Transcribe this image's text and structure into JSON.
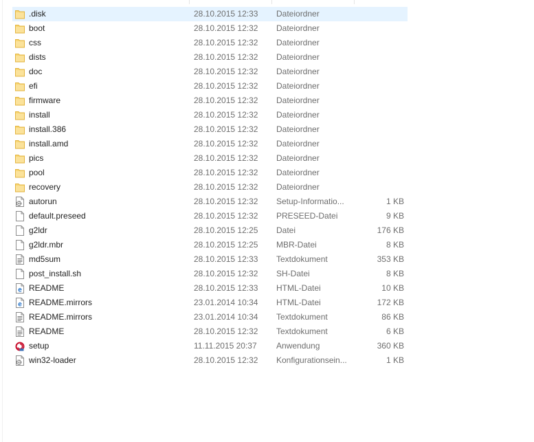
{
  "files": [
    {
      "name": ".disk",
      "date": "28.10.2015 12:33",
      "type": "Dateiordner",
      "size": "",
      "icon": "folder-icon",
      "selected": true
    },
    {
      "name": "boot",
      "date": "28.10.2015 12:32",
      "type": "Dateiordner",
      "size": "",
      "icon": "folder-icon"
    },
    {
      "name": "css",
      "date": "28.10.2015 12:32",
      "type": "Dateiordner",
      "size": "",
      "icon": "folder-icon"
    },
    {
      "name": "dists",
      "date": "28.10.2015 12:32",
      "type": "Dateiordner",
      "size": "",
      "icon": "folder-icon"
    },
    {
      "name": "doc",
      "date": "28.10.2015 12:32",
      "type": "Dateiordner",
      "size": "",
      "icon": "folder-icon"
    },
    {
      "name": "efi",
      "date": "28.10.2015 12:32",
      "type": "Dateiordner",
      "size": "",
      "icon": "folder-icon"
    },
    {
      "name": "firmware",
      "date": "28.10.2015 12:32",
      "type": "Dateiordner",
      "size": "",
      "icon": "folder-icon"
    },
    {
      "name": "install",
      "date": "28.10.2015 12:32",
      "type": "Dateiordner",
      "size": "",
      "icon": "folder-icon"
    },
    {
      "name": "install.386",
      "date": "28.10.2015 12:32",
      "type": "Dateiordner",
      "size": "",
      "icon": "folder-icon"
    },
    {
      "name": "install.amd",
      "date": "28.10.2015 12:32",
      "type": "Dateiordner",
      "size": "",
      "icon": "folder-icon"
    },
    {
      "name": "pics",
      "date": "28.10.2015 12:32",
      "type": "Dateiordner",
      "size": "",
      "icon": "folder-icon"
    },
    {
      "name": "pool",
      "date": "28.10.2015 12:32",
      "type": "Dateiordner",
      "size": "",
      "icon": "folder-icon"
    },
    {
      "name": "recovery",
      "date": "28.10.2015 12:32",
      "type": "Dateiordner",
      "size": "",
      "icon": "folder-icon"
    },
    {
      "name": "autorun",
      "date": "28.10.2015 12:32",
      "type": "Setup-Informatio...",
      "size": "1 KB",
      "icon": "settings-file-icon"
    },
    {
      "name": "default.preseed",
      "date": "28.10.2015 12:32",
      "type": "PRESEED-Datei",
      "size": "9 KB",
      "icon": "file-icon"
    },
    {
      "name": "g2ldr",
      "date": "28.10.2015 12:25",
      "type": "Datei",
      "size": "176 KB",
      "icon": "file-icon"
    },
    {
      "name": "g2ldr.mbr",
      "date": "28.10.2015 12:25",
      "type": "MBR-Datei",
      "size": "8 KB",
      "icon": "file-icon"
    },
    {
      "name": "md5sum",
      "date": "28.10.2015 12:33",
      "type": "Textdokument",
      "size": "353 KB",
      "icon": "text-file-icon"
    },
    {
      "name": "post_install.sh",
      "date": "28.10.2015 12:32",
      "type": "SH-Datei",
      "size": "8 KB",
      "icon": "file-icon"
    },
    {
      "name": "README",
      "date": "28.10.2015 12:33",
      "type": "HTML-Datei",
      "size": "10 KB",
      "icon": "html-file-icon"
    },
    {
      "name": "README.mirrors",
      "date": "23.01.2014 10:34",
      "type": "HTML-Datei",
      "size": "172 KB",
      "icon": "html-file-icon"
    },
    {
      "name": "README.mirrors",
      "date": "23.01.2014 10:34",
      "type": "Textdokument",
      "size": "86 KB",
      "icon": "text-file-icon"
    },
    {
      "name": "README",
      "date": "28.10.2015 12:32",
      "type": "Textdokument",
      "size": "6 KB",
      "icon": "text-file-icon"
    },
    {
      "name": "setup",
      "date": "11.11.2015 20:37",
      "type": "Anwendung",
      "size": "360 KB",
      "icon": "setup-app-icon"
    },
    {
      "name": "win32-loader",
      "date": "28.10.2015 12:32",
      "type": "Konfigurationsein...",
      "size": "1 KB",
      "icon": "settings-file-icon"
    }
  ],
  "colors": {
    "selection": "#e5f3ff",
    "folder": "#f8d775",
    "folder_dark": "#e8b940",
    "ie_blue": "#1e6fc8"
  }
}
